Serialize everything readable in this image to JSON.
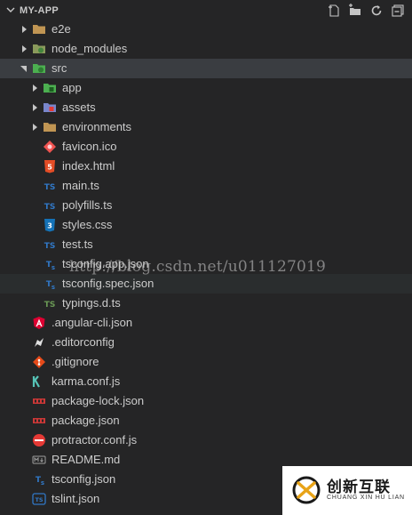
{
  "explorer": {
    "title": "MY-APP",
    "toolbar": [
      {
        "name": "new-file-icon"
      },
      {
        "name": "new-folder-icon"
      },
      {
        "name": "refresh-icon"
      },
      {
        "name": "collapse-all-icon"
      }
    ]
  },
  "tree": [
    {
      "label": "e2e",
      "icon": "folder",
      "depth": 1,
      "twisty": "collapsed"
    },
    {
      "label": "node_modules",
      "icon": "folder-node",
      "depth": 1,
      "twisty": "collapsed"
    },
    {
      "label": "src",
      "icon": "folder-src",
      "depth": 1,
      "twisty": "expanded",
      "state": "selected"
    },
    {
      "label": "app",
      "icon": "folder-app",
      "depth": 2,
      "twisty": "collapsed"
    },
    {
      "label": "assets",
      "icon": "folder-assets",
      "depth": 2,
      "twisty": "collapsed"
    },
    {
      "label": "environments",
      "icon": "folder",
      "depth": 2,
      "twisty": "collapsed"
    },
    {
      "label": "favicon.ico",
      "icon": "favicon",
      "depth": 2
    },
    {
      "label": "index.html",
      "icon": "html",
      "depth": 2
    },
    {
      "label": "main.ts",
      "icon": "ts",
      "depth": 2
    },
    {
      "label": "polyfills.ts",
      "icon": "ts",
      "depth": 2
    },
    {
      "label": "styles.css",
      "icon": "css",
      "depth": 2
    },
    {
      "label": "test.ts",
      "icon": "ts",
      "depth": 2
    },
    {
      "label": "tsconfig.app.json",
      "icon": "tsconfig",
      "depth": 2
    },
    {
      "label": "tsconfig.spec.json",
      "icon": "tsconfig",
      "depth": 2,
      "state": "hover"
    },
    {
      "label": "typings.d.ts",
      "icon": "tsdef",
      "depth": 2
    },
    {
      "label": ".angular-cli.json",
      "icon": "angular",
      "depth": 1
    },
    {
      "label": ".editorconfig",
      "icon": "editorconfig",
      "depth": 1
    },
    {
      "label": ".gitignore",
      "icon": "git",
      "depth": 1
    },
    {
      "label": "karma.conf.js",
      "icon": "karma",
      "depth": 1
    },
    {
      "label": "package-lock.json",
      "icon": "npm",
      "depth": 1
    },
    {
      "label": "package.json",
      "icon": "npm",
      "depth": 1
    },
    {
      "label": "protractor.conf.js",
      "icon": "protractor",
      "depth": 1
    },
    {
      "label": "README.md",
      "icon": "markdown",
      "depth": 1
    },
    {
      "label": "tsconfig.json",
      "icon": "tsconfig",
      "depth": 1
    },
    {
      "label": "tslint.json",
      "icon": "tslint",
      "depth": 1
    }
  ],
  "watermark": "http://blog.csdn.net/u011127019",
  "brand": {
    "name_cn": "创新互联",
    "name_en": "CHUANG XIN HU LIAN"
  },
  "colors": {
    "background": "#252526",
    "selected_row": "#3a3d41",
    "text": "#cccccc",
    "ts_blue": "#3178c6",
    "typings_green": "#6a9955",
    "html_orange": "#e44d26",
    "angular_red": "#dd0031",
    "npm_red": "#cb3837"
  }
}
